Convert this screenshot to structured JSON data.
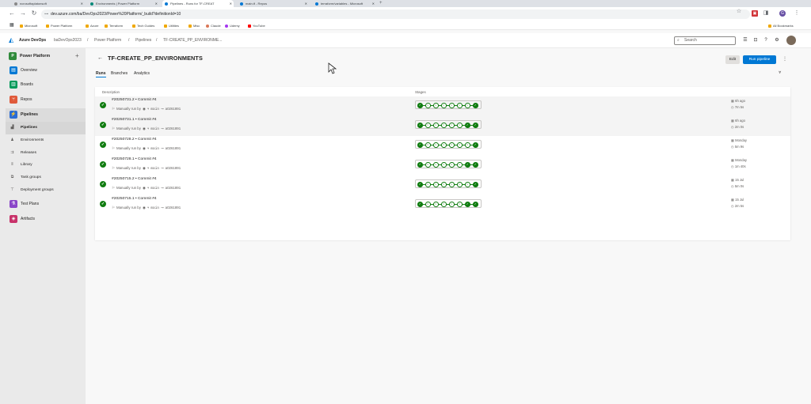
{
  "browser": {
    "tabs": [
      {
        "label": "ncrosoftaplatonsoft",
        "color": "#888"
      },
      {
        "label": "Environments | Power Platform",
        "color": "#0a8a7a"
      },
      {
        "label": "Pipelines - Runs for TF-CREAT",
        "color": "#0078d4"
      },
      {
        "label": "main.tf - Repos",
        "color": "#0078d4"
      },
      {
        "label": "terraform/variables - Microsoft",
        "color": "#0078d4"
      }
    ],
    "url": "dev.azure.com/ba/DevOps2023/Power%20Platform/_build?definitionId=10",
    "bookmarks": [
      "Microsoft",
      "Power Platform",
      "Azure",
      "Terraform",
      "Tech Guides",
      "Utilities",
      "Misc",
      "Claude",
      "Udemy",
      "YouTube"
    ],
    "all_bookmarks": "All Bookmarks"
  },
  "header": {
    "brand": "Azure DevOps",
    "org": "baDevOps2023",
    "crumbs": [
      "Power Platform",
      "Pipelines",
      "TF-CREATE_PP_ENVIRONME..."
    ],
    "search_placeholder": "Search"
  },
  "sidebar": {
    "project": "Power Platform",
    "project_initial": "P",
    "items": [
      {
        "label": "Overview",
        "color": "#0078d4",
        "icon": "overview-icon"
      },
      {
        "label": "Boards",
        "color": "#009a5a",
        "icon": "boards-icon"
      },
      {
        "label": "Repos",
        "color": "#e05a3a",
        "icon": "repos-icon"
      },
      {
        "label": "Pipelines",
        "color": "#2b6cd4",
        "icon": "pipelines-icon"
      }
    ],
    "subitems": [
      "Pipelines",
      "Environments",
      "Releases",
      "Library",
      "Task groups",
      "Deployment groups"
    ],
    "items2": [
      {
        "label": "Test Plans",
        "color": "#8a45c8",
        "icon": "test-plans-icon"
      },
      {
        "label": "Artifacts",
        "color": "#c8326a",
        "icon": "artifacts-icon"
      }
    ]
  },
  "main": {
    "title": "TF-CREATE_PP_ENVIRONMENTS",
    "edit": "Edit",
    "run": "Run pipeline",
    "tabs": [
      "Runs",
      "Branches",
      "Analytics"
    ],
    "col_description": "Description",
    "col_stages": "Stages",
    "runs": [
      {
        "id": "#20250731.2 • Commit #4",
        "trigger": "Manually run by",
        "branch": "main",
        "commit": "a0261891",
        "when": "6h ago",
        "duration": "7m 5s",
        "stages": [
          1,
          0,
          0,
          0,
          0,
          0,
          0,
          1
        ]
      },
      {
        "id": "#20250731.1 • Commit #4",
        "trigger": "Manually run by",
        "branch": "main",
        "commit": "a0261891",
        "when": "6h ago",
        "duration": "2m 0s",
        "stages": [
          1,
          0,
          0,
          0,
          0,
          0,
          1,
          1
        ]
      },
      {
        "id": "#20250728.2 • Commit #4",
        "trigger": "Manually run by",
        "branch": "main",
        "commit": "a0261891",
        "when": "Monday",
        "duration": "5m 9s",
        "stages": [
          1,
          0,
          0,
          0,
          0,
          0,
          0,
          1
        ]
      },
      {
        "id": "#20250728.1 • Commit #4",
        "trigger": "Manually run by",
        "branch": "main",
        "commit": "a0261891",
        "when": "Monday",
        "duration": "1m 40s",
        "stages": [
          1,
          0,
          0,
          0,
          0,
          0,
          1,
          1
        ]
      },
      {
        "id": "#20250715.2 • Commit #4",
        "trigger": "Manually run by",
        "branch": "main",
        "commit": "a0261891",
        "when": "15 Jul",
        "duration": "5m 0s",
        "stages": [
          1,
          0,
          0,
          0,
          0,
          0,
          0,
          1
        ]
      },
      {
        "id": "#20250715.1 • Commit #4",
        "trigger": "Manually run by",
        "branch": "main",
        "commit": "a0261891",
        "when": "15 Jul",
        "duration": "2m 5s",
        "stages": [
          1,
          0,
          0,
          0,
          0,
          0,
          1,
          1
        ]
      }
    ]
  }
}
